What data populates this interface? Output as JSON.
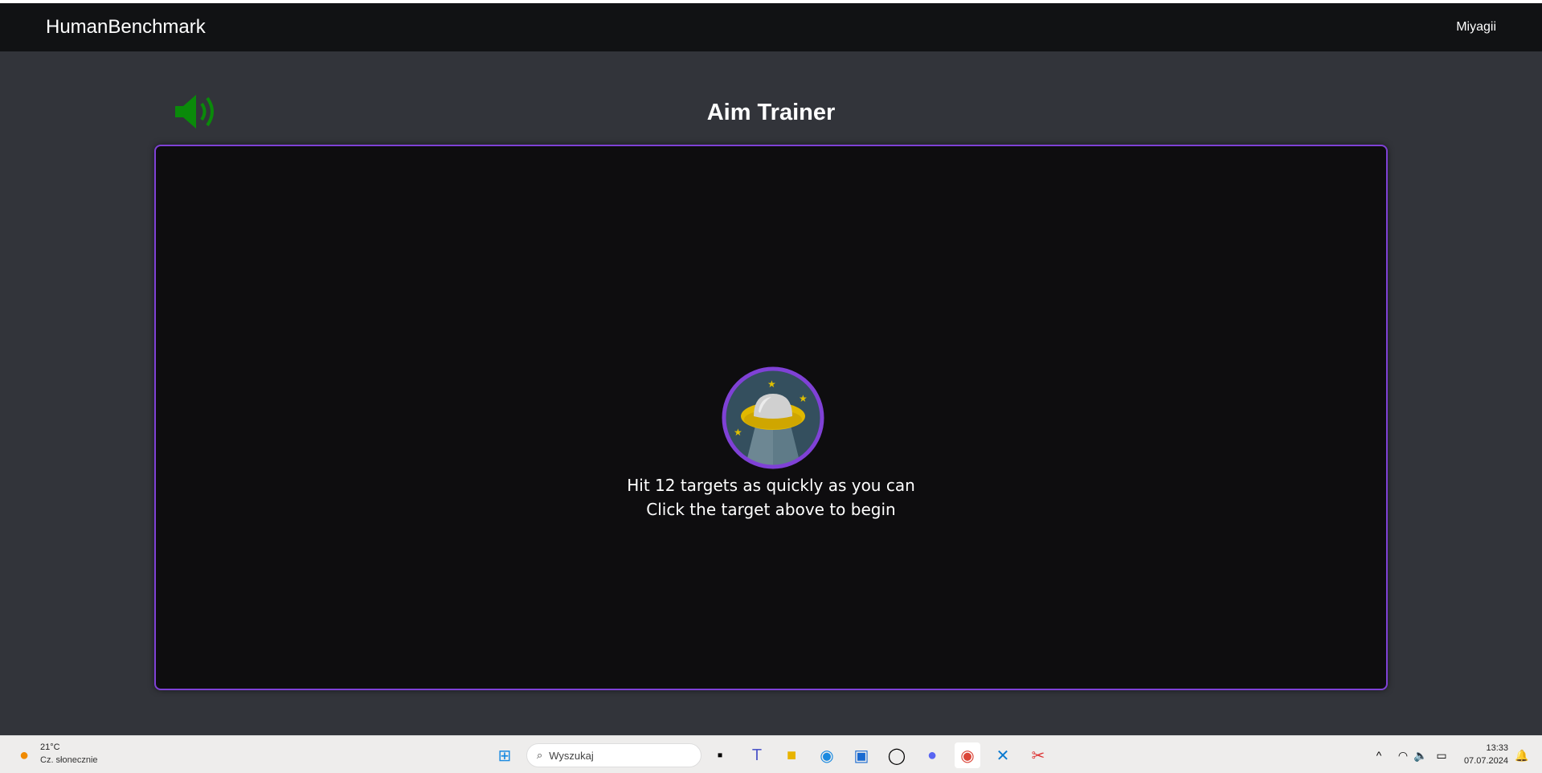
{
  "nav": {
    "brand": "HumanBenchmark",
    "user": "Miyagii"
  },
  "main": {
    "title": "Aim Trainer",
    "sound_icon": "speaker-on-icon",
    "sound_color": "#0a8a0a",
    "line1": "Hit 12 targets as quickly as you can",
    "line2": "Click the target above to begin"
  },
  "colors": {
    "accent": "#7f41d6",
    "game_bg": "#0e0d0f",
    "page_bg": "#32343a"
  },
  "taskbar": {
    "weather_temp": "21°C",
    "weather_desc": "Cz. słonecznie",
    "search_placeholder": "Wyszukaj",
    "time": "13:33",
    "date": "07.07.2024"
  }
}
